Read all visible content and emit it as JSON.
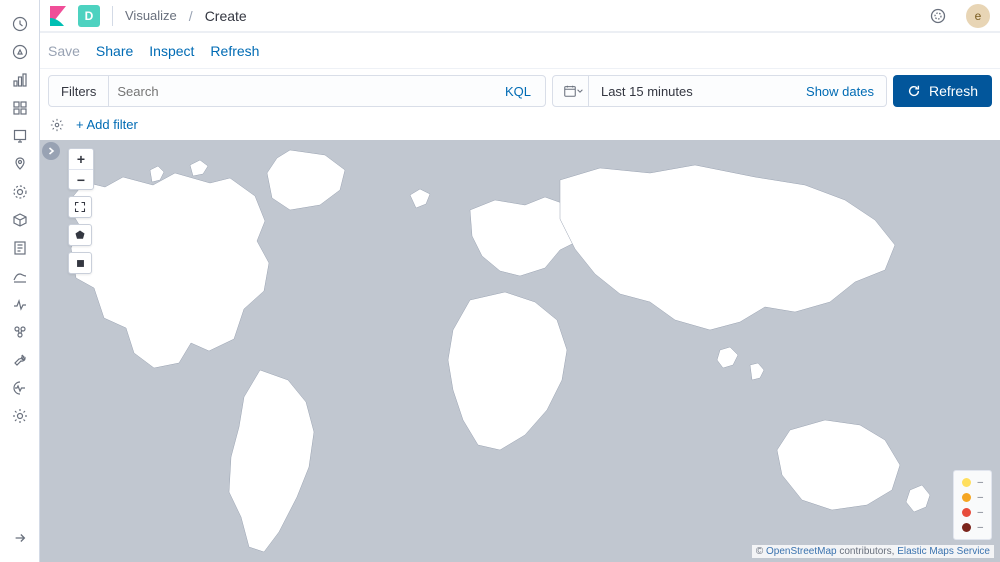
{
  "header": {
    "space_letter": "D",
    "breadcrumb_section": "Visualize",
    "breadcrumb_current": "Create",
    "avatar_letter": "e"
  },
  "toolbar": {
    "save": "Save",
    "share": "Share",
    "inspect": "Inspect",
    "refresh": "Refresh"
  },
  "query": {
    "filters_label": "Filters",
    "search_placeholder": "Search",
    "lang_label": "KQL",
    "time_label": "Last 15 minutes",
    "show_dates": "Show dates",
    "refresh_button": "Refresh",
    "add_filter": "+ Add filter"
  },
  "attribution": {
    "copyright": "©",
    "osm": "OpenStreetMap",
    "contrib": " contributors, ",
    "ems": "Elastic Maps Service"
  },
  "legend": {
    "dash": "–",
    "colors": [
      "#ffdf5e",
      "#f5a623",
      "#e74c3c",
      "#7b241c"
    ]
  },
  "sidenav_icons": [
    "recent-icon",
    "discover-icon",
    "visualize-icon",
    "dashboard-icon",
    "canvas-icon",
    "maps-icon",
    "ml-icon",
    "infra-icon",
    "logs-icon",
    "apm-icon",
    "uptime-icon",
    "siem-icon",
    "devtools-icon",
    "monitor-icon",
    "management-icon"
  ]
}
